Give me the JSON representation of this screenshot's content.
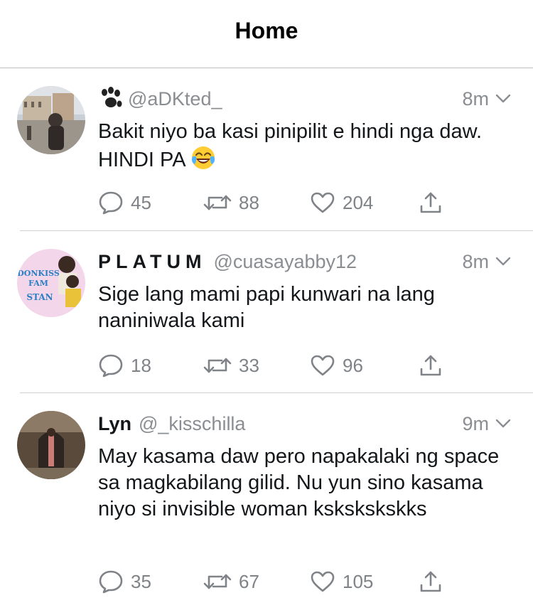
{
  "header": {
    "title": "Home"
  },
  "tweets": [
    {
      "name": "",
      "handle": "@aDKted_",
      "time": "8m",
      "text": "Bakit niyo ba kasi pinipilit e hindi nga daw. HINDI PA",
      "emoji": "face-with-tears-of-joy",
      "replies": "45",
      "retweets": "88",
      "likes": "204"
    },
    {
      "name": "PLATUM",
      "handle": "@cuasayabby12",
      "time": "8m",
      "text": "Sige lang mami papi kunwari na lang naniniwala kami",
      "avatar_text": [
        "DONKISS",
        "FAM",
        "STAN"
      ],
      "replies": "18",
      "retweets": "33",
      "likes": "96"
    },
    {
      "name": "Lyn",
      "handle": "@_kisschilla",
      "time": "9m",
      "text": "May kasama daw pero napakalaki ng space sa magkabilang gilid. Nu yun sino kasama niyo si invisible woman kskskskskks",
      "replies": "35",
      "retweets": "67",
      "likes": "105"
    }
  ],
  "colors": {
    "text": "#14171a",
    "muted": "#8a8d91",
    "divider": "#d0d0d4"
  }
}
